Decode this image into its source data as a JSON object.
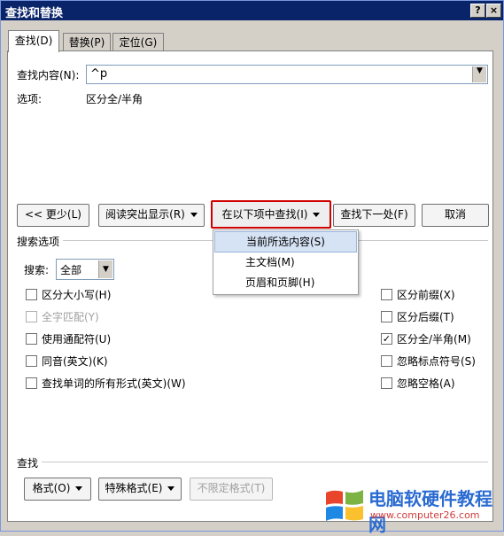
{
  "window": {
    "title": "查找和替换",
    "help": "?",
    "close": "×"
  },
  "tabs": [
    {
      "label": "查找(D)"
    },
    {
      "label": "替换(P)"
    },
    {
      "label": "定位(G)"
    }
  ],
  "find": {
    "label": "查找内容(N):",
    "value": "^p",
    "options_label": "选项:",
    "options_value": "区分全/半角"
  },
  "buttons": {
    "less": "<< 更少(L)",
    "reading_highlight": "阅读突出显示(R)",
    "find_in": "在以下项中查找(I)",
    "find_next": "查找下一处(F)",
    "cancel": "取消"
  },
  "dropdown": {
    "items": [
      {
        "label": "当前所选内容(S)"
      },
      {
        "label": "主文档(M)"
      },
      {
        "label": "页眉和页脚(H)"
      }
    ]
  },
  "search_options": {
    "heading": "搜索选项",
    "search_label": "搜索:",
    "search_value": "全部",
    "left": [
      {
        "label": "区分大小写(H)",
        "checked": false,
        "disabled": false
      },
      {
        "label": "全字匹配(Y)",
        "checked": false,
        "disabled": true
      },
      {
        "label": "使用通配符(U)",
        "checked": false,
        "disabled": false
      },
      {
        "label": "同音(英文)(K)",
        "checked": false,
        "disabled": false
      },
      {
        "label": "查找单词的所有形式(英文)(W)",
        "checked": false,
        "disabled": false
      }
    ],
    "right": [
      {
        "label": "区分前缀(X)",
        "checked": false
      },
      {
        "label": "区分后缀(T)",
        "checked": false
      },
      {
        "label": "区分全/半角(M)",
        "checked": true
      },
      {
        "label": "忽略标点符号(S)",
        "checked": false
      },
      {
        "label": "忽略空格(A)",
        "checked": false
      }
    ]
  },
  "find_section": {
    "heading": "查找",
    "format": "格式(O)",
    "special": "特殊格式(E)",
    "no_format": "不限定格式(T)"
  },
  "watermark": {
    "line1": "电脑软硬件教程网",
    "line2": "www.computer26.com"
  },
  "colors": {
    "titlebar": "#0a246a",
    "highlight_border": "#d00000",
    "menu_selected": "#d6e3f5"
  }
}
